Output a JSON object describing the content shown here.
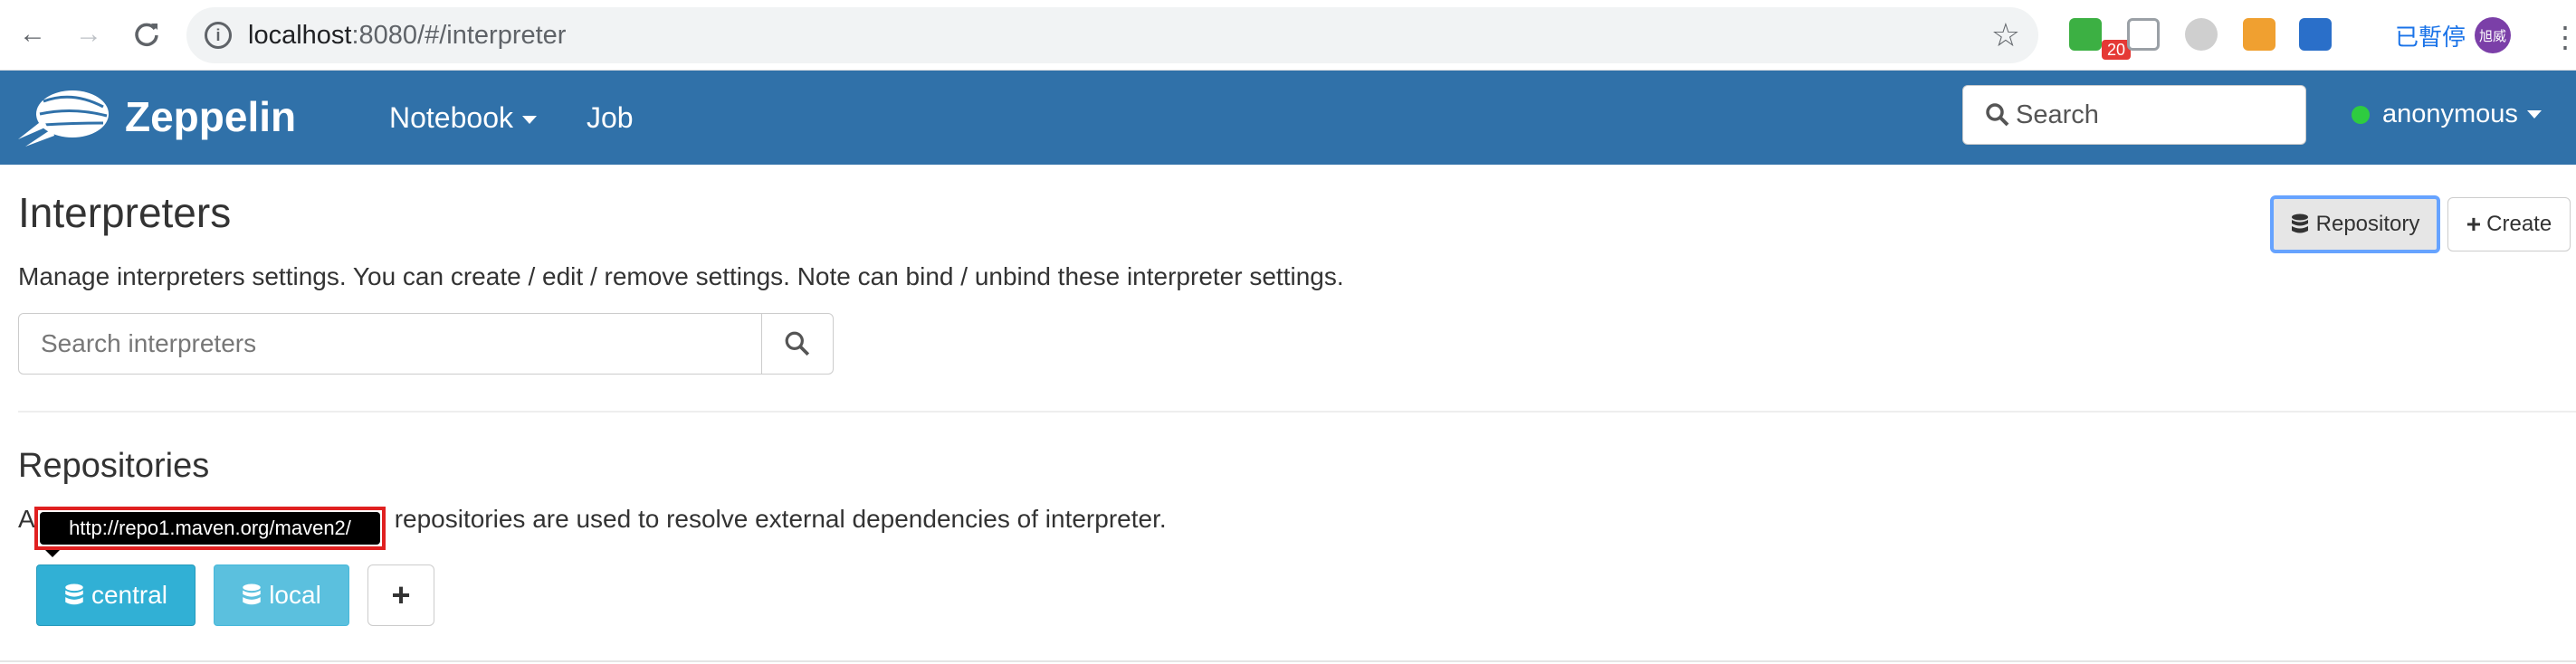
{
  "browser": {
    "url_host": "localhost",
    "url_path": ":8080/#/interpreter",
    "ext_badge": "20",
    "paused_label": "已暫停",
    "avatar_text": "旭威"
  },
  "navbar": {
    "brand": "Zeppelin",
    "notebook_label": "Notebook",
    "job_label": "Job",
    "search_placeholder": "Search",
    "user_label": "anonymous"
  },
  "page": {
    "title": "Interpreters",
    "description": "Manage interpreters settings. You can create / edit / remove settings. Note can bind / unbind these interpreter settings.",
    "repository_button": "Repository",
    "create_button": "Create",
    "search_placeholder": "Search interpreters"
  },
  "repositories": {
    "title": "Repositories",
    "description_prefix": "A",
    "description_suffix": "repositories are used to resolve external dependencies of interpreter.",
    "tooltip": "http://repo1.maven.org/maven2/",
    "items": [
      {
        "label": "central"
      },
      {
        "label": "local"
      }
    ],
    "add_label": "+"
  },
  "colors": {
    "navbar": "#3071a9",
    "repo_central": "#31b0d5",
    "repo_local": "#5bc0de",
    "status_online": "#2ecc40",
    "highlight": "#e02020"
  }
}
